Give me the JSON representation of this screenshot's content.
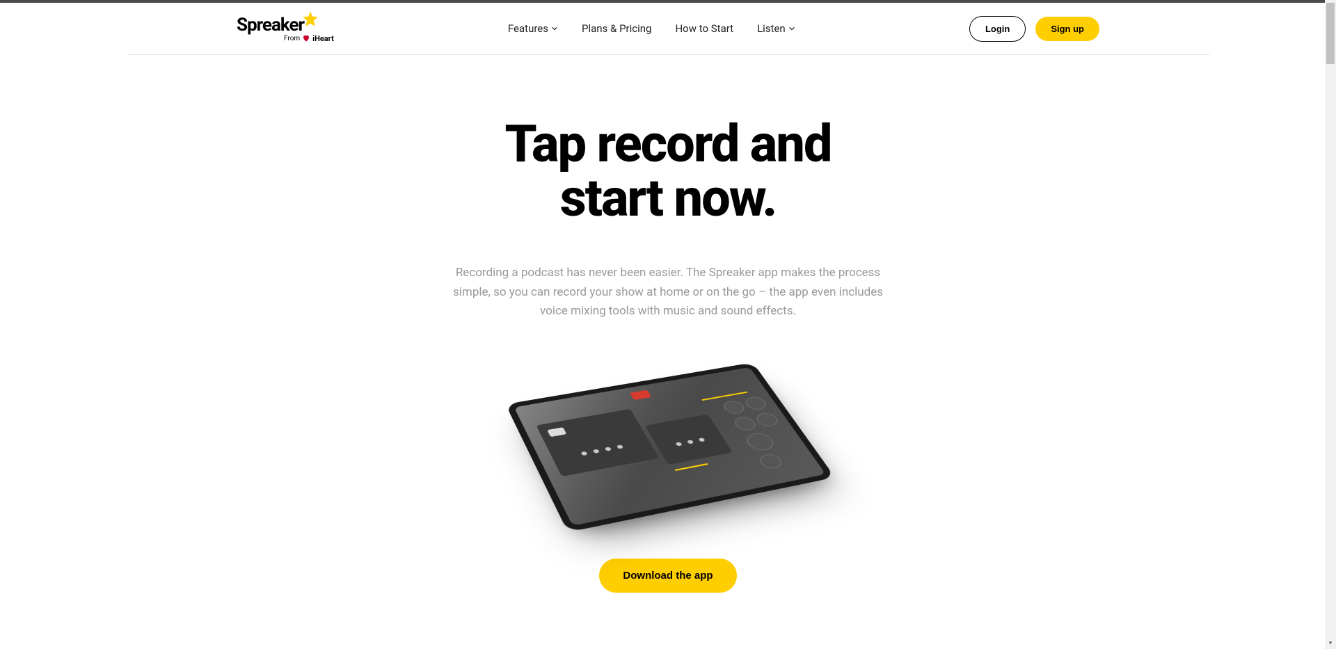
{
  "brand": {
    "name": "Spreaker",
    "tagline_prefix": "From",
    "tagline_brand": "iHeart"
  },
  "nav": {
    "items": [
      {
        "label": "Features",
        "has_dropdown": true
      },
      {
        "label": "Plans & Pricing",
        "has_dropdown": false
      },
      {
        "label": "How to Start",
        "has_dropdown": false
      },
      {
        "label": "Listen",
        "has_dropdown": true
      }
    ]
  },
  "actions": {
    "login": "Login",
    "signup": "Sign up"
  },
  "hero": {
    "title_line1": "Tap record and",
    "title_line2": "start now.",
    "description": "Recording a podcast has never been easier. The Spreaker app makes the process simple, so you can record your show at home or on the go – the app even includes voice mixing tools with music and sound effects."
  },
  "cta": {
    "download": "Download the app"
  },
  "colors": {
    "accent": "#FFCE00",
    "text_muted": "#999999"
  }
}
